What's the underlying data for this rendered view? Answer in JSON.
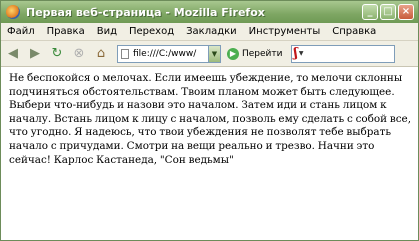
{
  "window": {
    "title": "Первая веб-страница - Mozilla Firefox",
    "controls": {
      "minimize": "_",
      "maximize": "□",
      "close": "×"
    }
  },
  "menubar": {
    "items": [
      {
        "label": "Файл"
      },
      {
        "label": "Правка"
      },
      {
        "label": "Вид"
      },
      {
        "label": "Переход"
      },
      {
        "label": "Закладки"
      },
      {
        "label": "Инструменты"
      },
      {
        "label": "Справка"
      }
    ]
  },
  "toolbar": {
    "back_icon": "◀",
    "forward_icon": "▶",
    "reload_icon": "↻",
    "stop_icon": "⊗",
    "home_icon": "⌂",
    "address_value": "file:///C:/www/",
    "address_dropdown": "▼",
    "go_label": "Перейти",
    "go_icon": "▶",
    "search_engine_glyph": "ʃ",
    "search_engine_caret": "▼"
  },
  "page": {
    "text": "Не беспокойся о мелочах. Если имеешь убеждение, то мелочи склонны подчиняться обстоятельствам. Твоим планом может быть следующее. Выбери что-нибудь и назови это началом. Затем иди и стань лицом к началу. Встань лицом к лицу с началом, позволь ему сделать с собой все, что угодно. Я надеюсь, что твои убеждения не позволят тебе выбрать начало с причудами. Смотри на вещи реально и трезво. Начни это сейчас! Карлос Кастанеда, \"Сон ведьмы\""
  }
}
